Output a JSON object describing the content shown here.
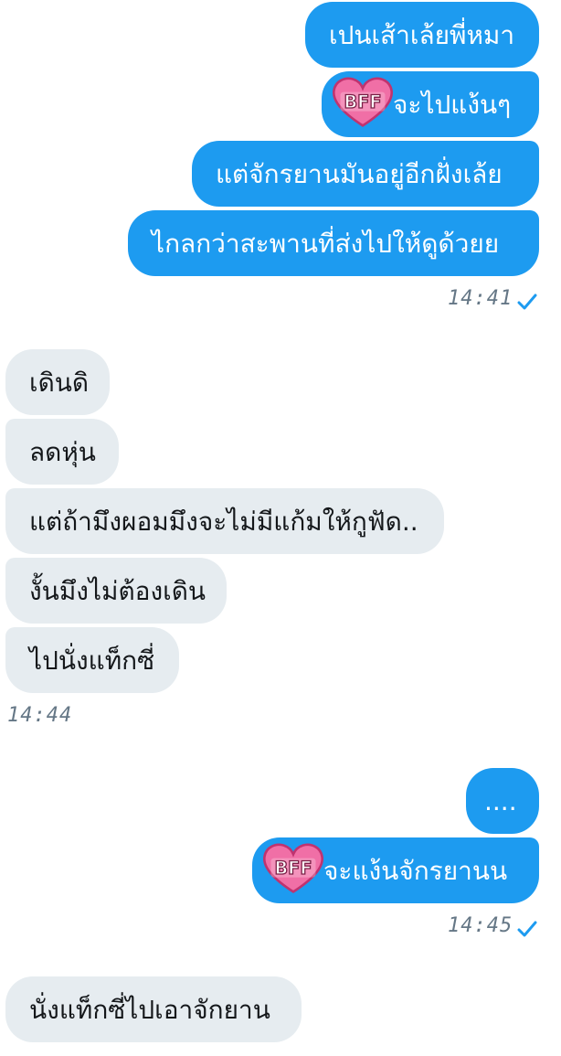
{
  "groups": [
    {
      "side": "sent",
      "messages": [
        {
          "text": "เปนเส้าเล้ยพี่หมา",
          "sticker": false
        },
        {
          "text": "จะไปแง้นๆ",
          "sticker": true
        },
        {
          "text": "แต่จักรยานมันอยู่อีกฝั่งเล้ย",
          "sticker": false
        },
        {
          "text": "ไกลกว่าสะพานที่ส่งไปให้ดูด้วยย",
          "sticker": false
        }
      ],
      "time": "14:41",
      "read": true
    },
    {
      "side": "received",
      "messages": [
        {
          "text": "เดินดิ"
        },
        {
          "text": "ลดหุ่น"
        },
        {
          "text": "แต่ถ้ามึงผอมมึงจะไม่มีแก้มให้กูฟัด.."
        },
        {
          "text": "งั้นมึงไม่ต้องเดิน"
        },
        {
          "text": "ไปนั่งแท็กซี่"
        }
      ],
      "time": "14:44"
    },
    {
      "side": "sent",
      "messages": [
        {
          "text": "....",
          "sticker": false
        },
        {
          "text": "จะแง้นจักรยานน",
          "sticker": true
        }
      ],
      "time": "14:45",
      "read": true
    },
    {
      "side": "received",
      "messages": [
        {
          "text": "นั่งแท็กซี่ไปเอาจักยาน"
        }
      ]
    }
  ],
  "sticker": {
    "label": "BFF",
    "icon": "bff-heart-sticker",
    "color": "#f06fa6"
  },
  "colors": {
    "sent_bubble": "#1d9bf0",
    "received_bubble": "#e6ecf0",
    "timestamp": "#657786",
    "check": "#1d9bf0"
  }
}
